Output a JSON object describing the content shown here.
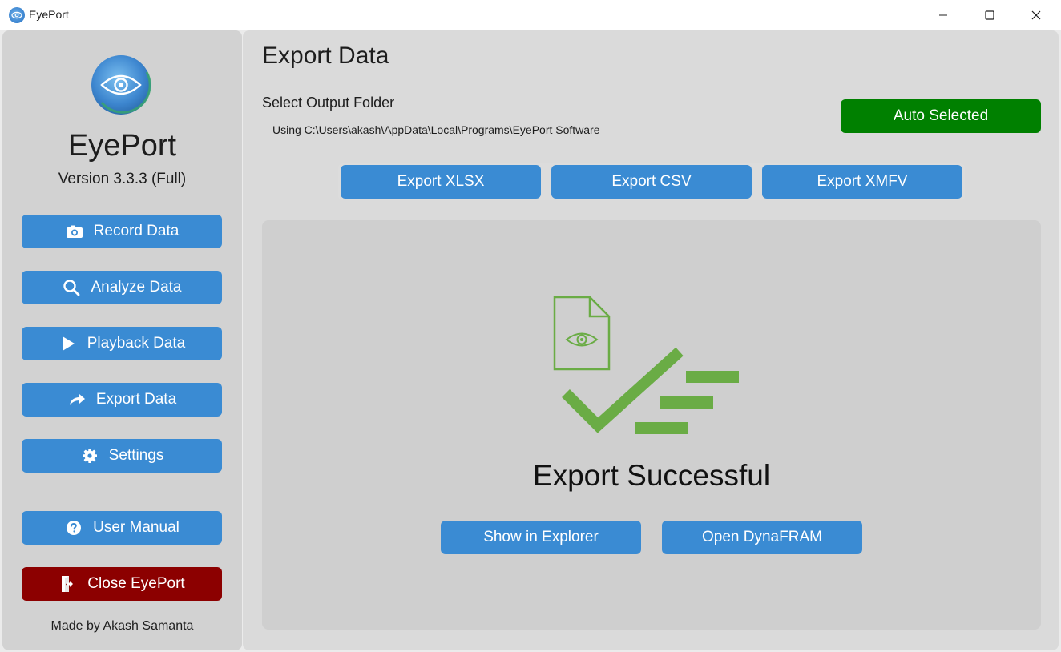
{
  "window": {
    "title": "EyePort",
    "icon": "eye-logo-icon",
    "controls": [
      "minimize-icon",
      "maximize-icon",
      "close-icon"
    ]
  },
  "sidebar": {
    "brand": "EyePort",
    "version": "Version 3.3.3 (Full)",
    "items": [
      {
        "label": "Record Data",
        "icon": "camera-icon"
      },
      {
        "label": "Analyze Data",
        "icon": "search-icon"
      },
      {
        "label": "Playback Data",
        "icon": "play-icon"
      },
      {
        "label": "Export Data",
        "icon": "share-arrow-icon"
      },
      {
        "label": "Settings",
        "icon": "gear-icon"
      },
      {
        "label": "User Manual",
        "icon": "help-icon"
      },
      {
        "label": "Close EyePort",
        "icon": "exit-icon"
      }
    ],
    "footer": "Made by Akash Samanta"
  },
  "main": {
    "title": "Export Data",
    "folder_label": "Select Output Folder",
    "folder_path": "Using C:\\Users\\akash\\AppData\\Local\\Programs\\EyePort Software",
    "auto_button": "Auto Selected",
    "export_buttons": [
      "Export XLSX",
      "Export CSV",
      "Export XMFV"
    ],
    "status_text": "Export Successful",
    "actions": [
      "Show in Explorer",
      "Open DynaFRAM"
    ]
  },
  "colors": {
    "accent": "#3a8bd3",
    "success": "#008000",
    "danger": "#8c0000",
    "graphic": "#6aac45"
  }
}
